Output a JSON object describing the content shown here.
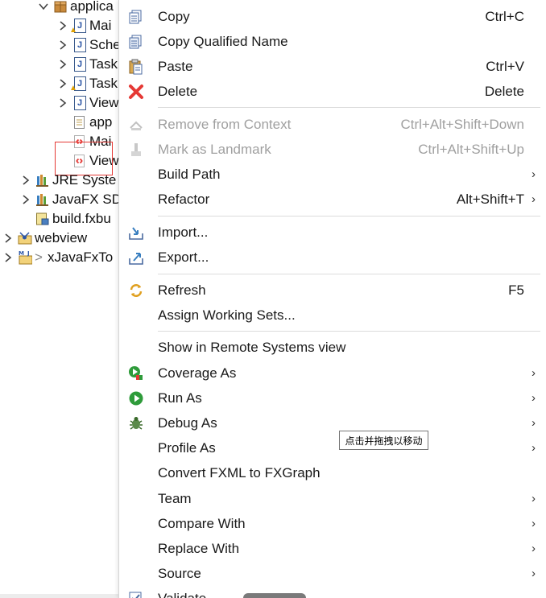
{
  "tree": {
    "items": [
      {
        "label": "applica",
        "kind": "package"
      },
      {
        "label": "Mai",
        "kind": "java-warn"
      },
      {
        "label": "Sche",
        "kind": "java"
      },
      {
        "label": "Task",
        "kind": "java"
      },
      {
        "label": "Task",
        "kind": "java-warn"
      },
      {
        "label": "View",
        "kind": "java"
      },
      {
        "label": "app",
        "kind": "css"
      },
      {
        "label": "Mai",
        "kind": "fxml"
      },
      {
        "label": "View",
        "kind": "fxml-selected"
      },
      {
        "label": "JRE Syste",
        "kind": "library"
      },
      {
        "label": "JavaFX SD",
        "kind": "library"
      },
      {
        "label": "build.fxbu",
        "kind": "build"
      },
      {
        "label": "webview",
        "kind": "project"
      },
      {
        "label": "xJavaFxTo",
        "kind": "maven-project",
        "prefix": ">"
      }
    ]
  },
  "menu": {
    "items": [
      {
        "label": "Copy",
        "shortcut": "Ctrl+C",
        "icon": "copy-icon"
      },
      {
        "label": "Copy Qualified Name",
        "shortcut": "",
        "icon": "copy-qualified-name-icon"
      },
      {
        "label": "Paste",
        "shortcut": "Ctrl+V",
        "icon": "paste-icon"
      },
      {
        "label": "Delete",
        "shortcut": "Delete",
        "icon": "delete-icon"
      },
      {
        "label": "Remove from Context",
        "shortcut": "Ctrl+Alt+Shift+Down",
        "icon": "remove-context-icon",
        "disabled": true
      },
      {
        "label": "Mark as Landmark",
        "shortcut": "Ctrl+Alt+Shift+Up",
        "icon": "landmark-icon",
        "disabled": true
      },
      {
        "label": "Build Path",
        "submenu": true
      },
      {
        "label": "Refactor",
        "shortcut": "Alt+Shift+T",
        "submenu": true
      },
      {
        "label": "Import...",
        "icon": "import-icon"
      },
      {
        "label": "Export...",
        "icon": "export-icon"
      },
      {
        "label": "Refresh",
        "shortcut": "F5",
        "icon": "refresh-icon"
      },
      {
        "label": "Assign Working Sets..."
      },
      {
        "label": "Show in Remote Systems view"
      },
      {
        "label": "Coverage As",
        "submenu": true,
        "icon": "coverage-icon"
      },
      {
        "label": "Run As",
        "submenu": true,
        "icon": "run-icon"
      },
      {
        "label": "Debug As",
        "submenu": true,
        "icon": "debug-bug-icon"
      },
      {
        "label": "Profile As",
        "submenu": true
      },
      {
        "label": "Convert FXML to FXGraph"
      },
      {
        "label": "Team",
        "submenu": true
      },
      {
        "label": "Compare With",
        "submenu": true
      },
      {
        "label": "Replace With",
        "submenu": true
      },
      {
        "label": "Source",
        "submenu": true
      },
      {
        "label": "Validate",
        "icon": "validate-icon"
      }
    ],
    "submenu_arrow": "›"
  },
  "tooltip": {
    "text": "点击并拖拽以移动"
  },
  "colors": {
    "accent_red": "#e53935",
    "disabled": "#a0a0a0",
    "run_green": "#2e9b3a"
  }
}
